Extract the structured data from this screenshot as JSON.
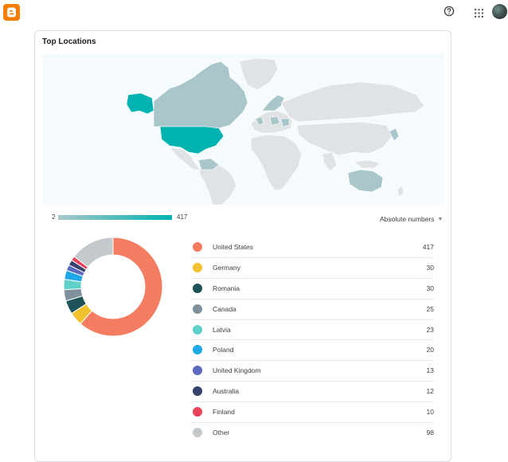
{
  "header": {
    "logo_icon": "blogger-logo-icon",
    "help_icon": "help-circle-icon",
    "apps_icon": "apps-grid-icon",
    "avatar_icon": "user-avatar"
  },
  "card": {
    "title": "Top Locations",
    "map": {
      "legend_min": "2",
      "legend_max": "417",
      "highlight_colors": {
        "united_states": "#00b2b0",
        "alaska": "#00b2b0",
        "europe_shaded": "#a9c7ca"
      }
    },
    "mode_selector": {
      "value": "Absolute numbers"
    },
    "rows": [
      {
        "country": "United States",
        "value": "417",
        "color": "#f47c60"
      },
      {
        "country": "Germany",
        "value": "30",
        "color": "#f2c12e"
      },
      {
        "country": "Romania",
        "value": "30",
        "color": "#1e5357"
      },
      {
        "country": "Canada",
        "value": "25",
        "color": "#7f919c"
      },
      {
        "country": "Latvia",
        "value": "23",
        "color": "#5fd1c8"
      },
      {
        "country": "Poland",
        "value": "20",
        "color": "#1ea7e6"
      },
      {
        "country": "United Kingdom",
        "value": "13",
        "color": "#5c6bc0"
      },
      {
        "country": "Australia",
        "value": "12",
        "color": "#36426b"
      },
      {
        "country": "Finland",
        "value": "10",
        "color": "#e8435b"
      },
      {
        "country": "Other",
        "value": "98",
        "color": "#c3c9cd"
      }
    ]
  }
}
